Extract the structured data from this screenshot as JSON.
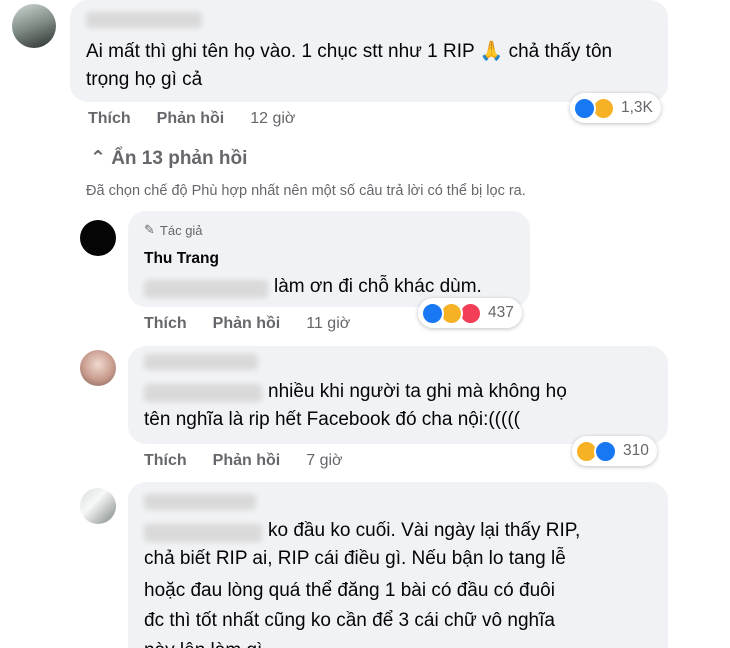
{
  "comments": [
    {
      "id": "c1",
      "author": "Van Nguyen",
      "text": "Ai mất thì ghi tên họ vào. 1 chục stt như 1 RIP 🙏 chả thấy tôn trọng họ gì cả",
      "actions": {
        "like": "Thích",
        "reply": "Phản hồi",
        "time": "12 giờ"
      },
      "reactions": {
        "icons": [
          "like-icon",
          "haha-icon"
        ],
        "count": "1,3K"
      }
    },
    {
      "id": "c2",
      "author_badge": "Tác giả",
      "author": "Thu Trang",
      "mention": "Van Nguyen",
      "text": "làm ơn đi chỗ khác dùm.",
      "actions": {
        "like": "Thích",
        "reply": "Phản hồi",
        "time": "11 giờ"
      },
      "reactions": {
        "icons": [
          "like-icon",
          "haha-icon",
          "love-icon"
        ],
        "count": "437"
      }
    },
    {
      "id": "c3",
      "author": "Thanh Hoài",
      "mention": "Van Nguyen",
      "text_line1": "nhiều khi người ta ghi mà không họ",
      "text_line2": "tên nghĩa là rip hết Facebook đó cha nội:(((((",
      "actions": {
        "like": "Thích",
        "reply": "Phản hồi",
        "time": "7 giờ"
      },
      "reactions": {
        "icons": [
          "haha-icon",
          "like-icon"
        ],
        "count": "310"
      }
    },
    {
      "id": "c4",
      "author": "Linh Nguyễn",
      "mention": "Van Nguyen",
      "text_line1": "ko đầu ko cuối. Vài ngày lại thấy RIP,",
      "text_line2": "chả biết RIP ai, RIP cái điều gì. Nếu bận lo tang lễ",
      "text_line3": "hoặc đau lòng quá thể đăng 1 bài có đầu có đuôi",
      "text_line4": "đc thì tốt nhất cũng ko cần để 3 cái chữ vô nghĩa",
      "text_line5": "này lên làm gì"
    }
  ],
  "thread": {
    "hide_replies": "Ẩn 13 phản hồi",
    "filter_notice": "Đã chọn chế độ Phù hợp nhất nên một số câu trả lời có thể bị lọc ra."
  },
  "colors": {
    "bubble": "#f0f2f5",
    "meta": "#65676b",
    "like": "#1877f2",
    "haha": "#f7b125",
    "love": "#f33e58"
  }
}
